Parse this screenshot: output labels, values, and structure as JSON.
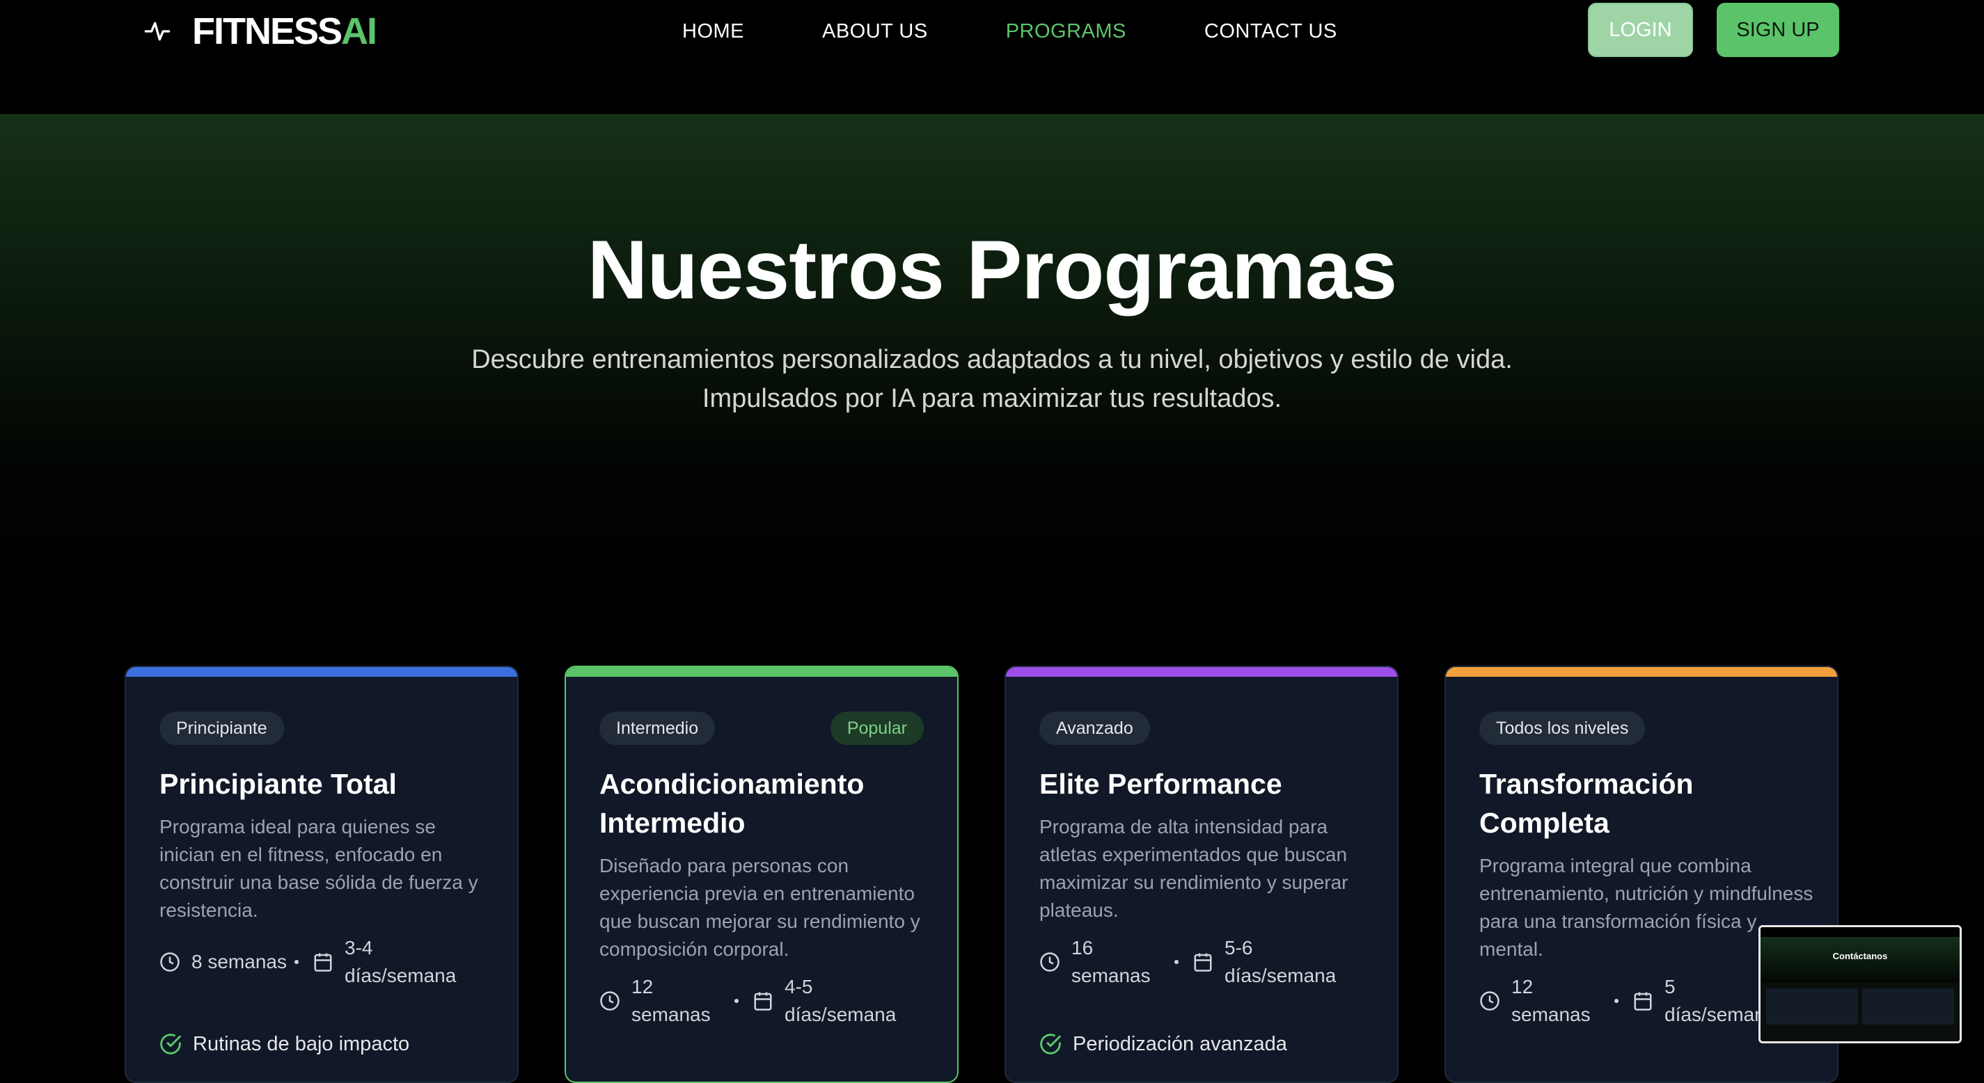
{
  "brand": {
    "name_main": "FITNESS",
    "name_accent": "AI",
    "accent_color": "#5bc46a"
  },
  "nav": {
    "links": [
      {
        "label": "HOME",
        "active": false
      },
      {
        "label": "ABOUT US",
        "active": false
      },
      {
        "label": "PROGRAMS",
        "active": true
      },
      {
        "label": "CONTACT US",
        "active": false
      }
    ],
    "login_label": "LOGIN",
    "signup_label": "SIGN UP"
  },
  "hero": {
    "title": "Nuestros Programas",
    "subtitle": "Descubre entrenamientos personalizados adaptados a tu nivel, objetivos y estilo de vida. Impulsados por IA para maximizar tus resultados."
  },
  "programs": [
    {
      "level": "Principiante",
      "title": "Principiante Total",
      "description": "Programa ideal para quienes se inician en el fitness, enfocado en construir una base sólida de fuerza y resistencia.",
      "duration": "8 semanas",
      "frequency": "3-4 días/semana",
      "feature": "Rutinas de bajo impacto",
      "accent": "#3b6fe0"
    },
    {
      "level": "Intermedio",
      "badge": "Popular",
      "title": "Acondicionamiento Intermedio",
      "description": "Diseñado para personas con experiencia previa en entrenamiento que buscan mejorar su rendimiento y composición corporal.",
      "duration": "12 semanas",
      "frequency": "4-5 días/semana",
      "accent": "#5bc46a"
    },
    {
      "level": "Avanzado",
      "title": "Elite Performance",
      "description": "Programa de alta intensidad para atletas experimentados que buscan maximizar su rendimiento y superar plateaus.",
      "duration": "16 semanas",
      "frequency": "5-6 días/semana",
      "feature": "Periodización avanzada",
      "accent": "#9b4ee8"
    },
    {
      "level": "Todos los niveles",
      "title": "Transformación Completa",
      "description": "Programa integral que combina entrenamiento, nutrición y mindfulness para una transformación física y mental.",
      "duration": "12 semanas",
      "frequency": "5 días/semana",
      "accent": "#f0a03c"
    }
  ],
  "preview_thumbnail": {
    "title": "Contáctanos"
  }
}
